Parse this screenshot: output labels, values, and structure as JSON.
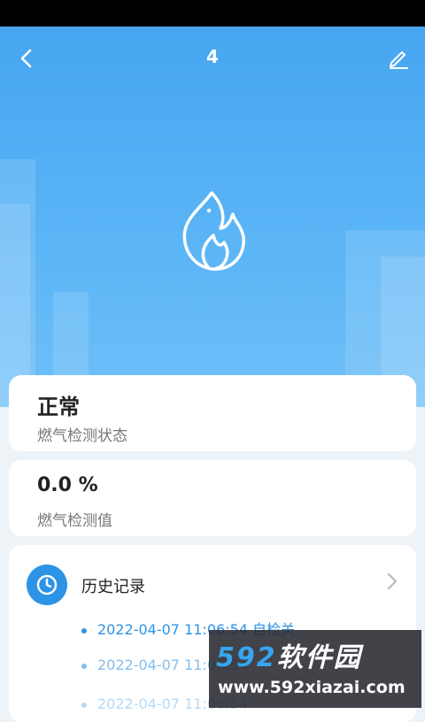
{
  "nav": {
    "title": "4"
  },
  "status_card": {
    "value": "正常",
    "label": "燃气检测状态"
  },
  "value_card": {
    "value": "0.0 %",
    "label": "燃气检测值"
  },
  "history": {
    "title": "历史记录",
    "records": [
      {
        "text": "2022-04-07 11:06:54 自检关"
      },
      {
        "text": "2022-04-07 11:06:54"
      },
      {
        "text": "2022-04-07 11:06:54"
      }
    ]
  },
  "watermark": {
    "brand_number": "592",
    "brand_text": "软件园",
    "url": "www.592xiazai.com"
  },
  "colors": {
    "accent": "#2d93e6",
    "hero": "#5ab4f6"
  },
  "icons": [
    "back-arrow-icon",
    "edit-pencil-icon",
    "flame-icon",
    "clock-icon",
    "chevron-right-icon"
  ]
}
